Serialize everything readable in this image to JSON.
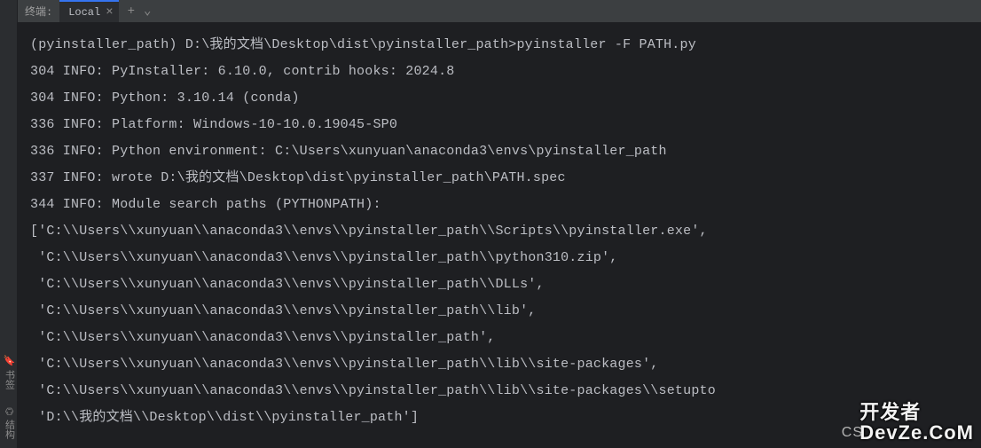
{
  "left_sidebar": {
    "bookmarks": "书签",
    "structure": "结构"
  },
  "tab_bar": {
    "label": "终端:",
    "tab_name": "Local",
    "add": "+",
    "dropdown": "⌄"
  },
  "terminal": {
    "lines": [
      "(pyinstaller_path) D:\\我的文档\\Desktop\\dist\\pyinstaller_path>pyinstaller -F PATH.py",
      "304 INFO: PyInstaller: 6.10.0, contrib hooks: 2024.8",
      "304 INFO: Python: 3.10.14 (conda)",
      "336 INFO: Platform: Windows-10-10.0.19045-SP0",
      "336 INFO: Python environment: C:\\Users\\xunyuan\\anaconda3\\envs\\pyinstaller_path",
      "337 INFO: wrote D:\\我的文档\\Desktop\\dist\\pyinstaller_path\\PATH.spec",
      "344 INFO: Module search paths (PYTHONPATH):",
      "['C:\\\\Users\\\\xunyuan\\\\anaconda3\\\\envs\\\\pyinstaller_path\\\\Scripts\\\\pyinstaller.exe',",
      " 'C:\\\\Users\\\\xunyuan\\\\anaconda3\\\\envs\\\\pyinstaller_path\\\\python310.zip',",
      " 'C:\\\\Users\\\\xunyuan\\\\anaconda3\\\\envs\\\\pyinstaller_path\\\\DLLs',",
      " 'C:\\\\Users\\\\xunyuan\\\\anaconda3\\\\envs\\\\pyinstaller_path\\\\lib',",
      " 'C:\\\\Users\\\\xunyuan\\\\anaconda3\\\\envs\\\\pyinstaller_path',",
      " 'C:\\\\Users\\\\xunyuan\\\\anaconda3\\\\envs\\\\pyinstaller_path\\\\lib\\\\site-packages',",
      " 'C:\\\\Users\\\\xunyuan\\\\anaconda3\\\\envs\\\\pyinstaller_path\\\\lib\\\\site-packages\\\\setupto",
      " 'D:\\\\我的文档\\\\Desktop\\\\dist\\\\pyinstaller_path']"
    ]
  },
  "watermark": {
    "line1": "开发者",
    "line2": "DevZe.CoM",
    "cs": "CS"
  }
}
